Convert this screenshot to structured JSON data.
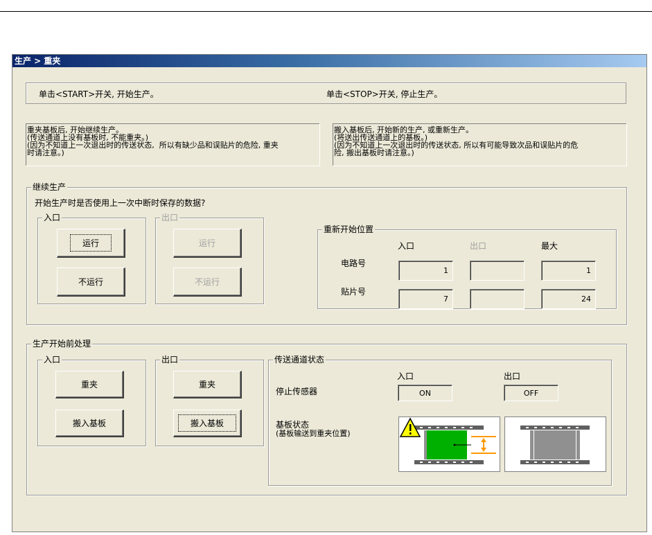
{
  "window": {
    "title": "生产 > 重夹"
  },
  "header_panel": {
    "start_text": "单击<START>开关, 开始生产。",
    "stop_text": "单击<STOP>开关, 停止生产。"
  },
  "info_left": {
    "line1": "重夹基板后, 开始继续生产。",
    "line2": "(传送通道上没有基板时, 不能重夹。)",
    "line3": "(因为不知道上一次退出时的传送状态,  所以有缺少品和误贴片的危险, 重夹",
    "line4": "时请注意。)"
  },
  "info_right": {
    "line1": "搬入基板后, 开始新的生产, 或重新生产。",
    "line2": "(将送出传送通道上的基板。)",
    "line3": "(因为不知道上一次退出时的传送状态, 所以有可能导致次品和误贴片的危",
    "line4": "险, 搬出基板时请注意。)"
  },
  "continue_group": {
    "title": "继续生产",
    "question": "开始生产时是否使用上一次中断时保存的数据?",
    "entry": {
      "title": "入口",
      "run": "运行",
      "not_run": "不运行"
    },
    "exit": {
      "title": "出口",
      "run": "运行",
      "not_run": "不运行"
    },
    "restart": {
      "title": "重新开始位置",
      "col_entry": "入口",
      "col_exit": "出口",
      "col_max": "最大",
      "row_circuit": "电路号",
      "row_placement": "贴片号",
      "circuit": {
        "entry": "1",
        "exit": "",
        "max": "1"
      },
      "placement": {
        "entry": "7",
        "exit": "",
        "max": "24"
      }
    }
  },
  "preprocess_group": {
    "title": "生产开始前处理",
    "entry": {
      "title": "入口",
      "reclamp": "重夹",
      "load": "搬入基板"
    },
    "exit": {
      "title": "出口",
      "reclamp": "重夹",
      "load": "搬入基板"
    },
    "conveyor": {
      "title": "传送通道状态",
      "col_entry": "入口",
      "col_exit": "出口",
      "stop_sensor_label": "停止传感器",
      "stop_sensor_entry": "ON",
      "stop_sensor_exit": "OFF",
      "board_state_label": "基板状态",
      "board_state_sub": "(基板输送到重夹位置)"
    }
  },
  "colors": {
    "title_start": "#0a246a",
    "title_end": "#a6caf0",
    "window_bg": "#ece9d8",
    "board_present": "#00b000",
    "board_absent": "#909090",
    "arrow": "#ff9900",
    "warning": "#ffff00"
  },
  "icons": [
    "warning-icon",
    "board-entry-image",
    "board-exit-image"
  ]
}
